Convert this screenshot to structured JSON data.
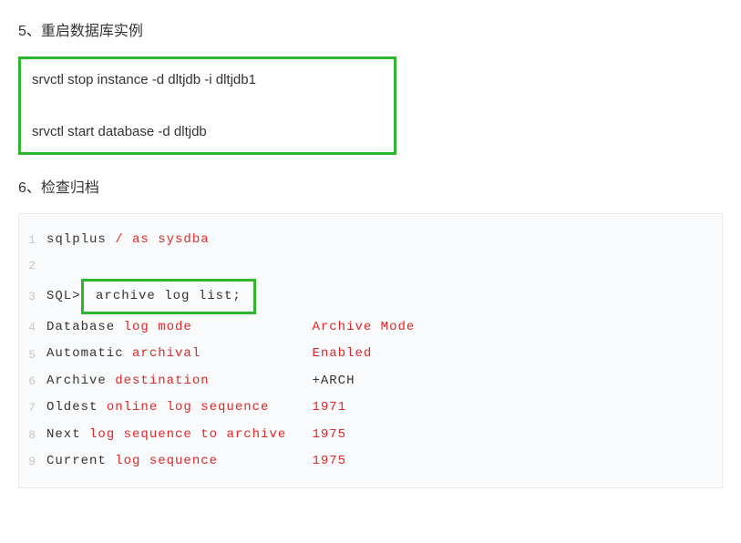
{
  "section5": {
    "heading": "5、重启数据库实例",
    "cmd1": "srvctl stop  instance -d dltjdb  -i dltjdb1",
    "cmd2": "srvctl start database -d  dltjdb"
  },
  "section6": {
    "heading": "6、检查归档"
  },
  "code": {
    "lines": [
      {
        "num": "1",
        "parts": [
          {
            "t": "sqlplus ",
            "c": "black"
          },
          {
            "t": "/ as sysdba",
            "c": "red"
          }
        ]
      },
      {
        "num": "2",
        "parts": []
      },
      {
        "num": "3",
        "prefix": "SQL>",
        "boxed": " archive log list; "
      },
      {
        "num": "4",
        "parts": [
          {
            "t": "Database ",
            "c": "black"
          },
          {
            "t": "log mode",
            "c": "red"
          },
          {
            "t": "              ",
            "c": "black"
          },
          {
            "t": "Archive Mode",
            "c": "red"
          }
        ]
      },
      {
        "num": "5",
        "parts": [
          {
            "t": "Automatic ",
            "c": "black"
          },
          {
            "t": "archival",
            "c": "red"
          },
          {
            "t": "             ",
            "c": "black"
          },
          {
            "t": "Enabled",
            "c": "red"
          }
        ]
      },
      {
        "num": "6",
        "parts": [
          {
            "t": "Archive ",
            "c": "black"
          },
          {
            "t": "destination",
            "c": "red"
          },
          {
            "t": "            +ARCH",
            "c": "black"
          }
        ]
      },
      {
        "num": "7",
        "parts": [
          {
            "t": "Oldest ",
            "c": "black"
          },
          {
            "t": "online log sequence",
            "c": "red"
          },
          {
            "t": "     ",
            "c": "black"
          },
          {
            "t": "1971",
            "c": "red"
          }
        ]
      },
      {
        "num": "8",
        "parts": [
          {
            "t": "Next ",
            "c": "black"
          },
          {
            "t": "log sequence to archive",
            "c": "red"
          },
          {
            "t": "   ",
            "c": "black"
          },
          {
            "t": "1975",
            "c": "red"
          }
        ]
      },
      {
        "num": "9",
        "parts": [
          {
            "t": "Current ",
            "c": "black"
          },
          {
            "t": "log sequence",
            "c": "red"
          },
          {
            "t": "           ",
            "c": "black"
          },
          {
            "t": "1975",
            "c": "red"
          }
        ]
      }
    ]
  }
}
